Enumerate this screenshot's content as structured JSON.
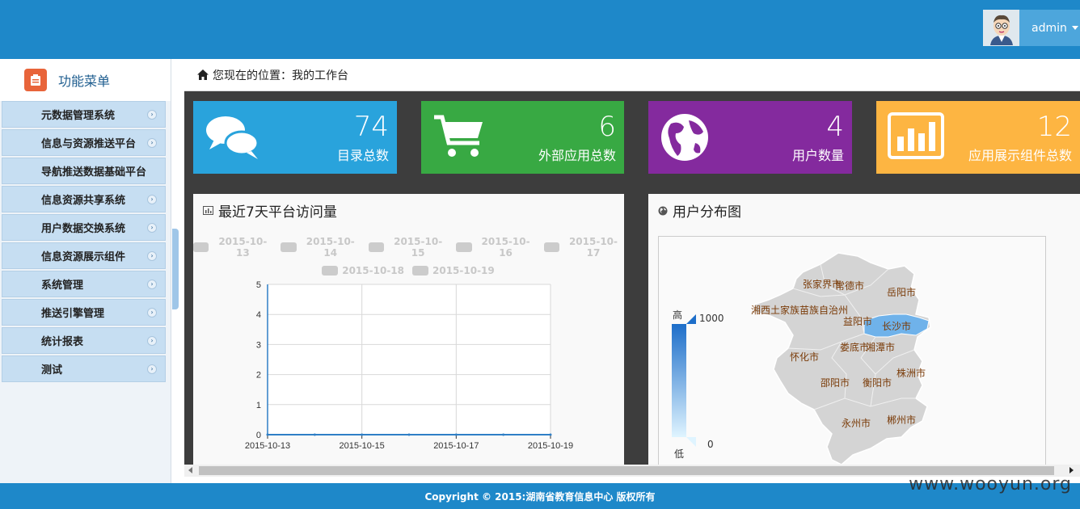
{
  "header": {
    "user_name": "admin"
  },
  "sidebar": {
    "title": "功能菜单",
    "items": [
      {
        "label": "元数据管理系统",
        "chevron": true
      },
      {
        "label": "信息与资源推送平台",
        "chevron": true
      },
      {
        "label": "导航推送数据基础平台",
        "chevron": false
      },
      {
        "label": "信息资源共享系统",
        "chevron": true
      },
      {
        "label": "用户数据交换系统",
        "chevron": true
      },
      {
        "label": "信息资源展示组件",
        "chevron": true
      },
      {
        "label": "系统管理",
        "chevron": true
      },
      {
        "label": "推送引擎管理",
        "chevron": true
      },
      {
        "label": "统计报表",
        "chevron": true
      },
      {
        "label": "测试",
        "chevron": true
      }
    ]
  },
  "breadcrumb": {
    "text": "您现在的位置：我的工作台"
  },
  "stats": [
    {
      "value": "74",
      "label": "目录总数",
      "color": "#29a3dc",
      "icon": "chat-icon"
    },
    {
      "value": "6",
      "label": "外部应用总数",
      "color": "#38a943",
      "icon": "cart-icon"
    },
    {
      "value": "4",
      "label": "用户数量",
      "color": "#842a9e",
      "icon": "globe-icon"
    },
    {
      "value": "12",
      "label": "应用展示组件总数",
      "color": "#fdb542",
      "icon": "bar-chart-icon"
    }
  ],
  "visits_panel": {
    "title": "最近7天平台访问量"
  },
  "map_panel": {
    "title": "用户分布图",
    "scale_high": "高",
    "scale_low": "低",
    "scale_max": "1000",
    "scale_min": "0",
    "cities": [
      "张家界市",
      "常德市",
      "岳阳市",
      "湘西土家族苗族自治州",
      "益阳市",
      "长沙市",
      "怀化市",
      "娄底市",
      "湘潭市",
      "株洲市",
      "邵阳市",
      "衡阳市",
      "永州市",
      "郴州市"
    ],
    "highlight_city": "长沙市",
    "highlight_color": "#6fb2ea",
    "region_color": "#d4d4d4"
  },
  "chart_data": {
    "type": "line",
    "title": "最近7天平台访问量",
    "legend": [
      "2015-10-13",
      "2015-10-14",
      "2015-10-15",
      "2015-10-16",
      "2015-10-17",
      "2015-10-18",
      "2015-10-19"
    ],
    "x": [
      "2015-10-13",
      "2015-10-14",
      "2015-10-15",
      "2015-10-16",
      "2015-10-17",
      "2015-10-18",
      "2015-10-19"
    ],
    "x_tick_labels": [
      "2015-10-13",
      "2015-10-15",
      "2015-10-17",
      "2015-10-19"
    ],
    "series": [
      {
        "values": [
          0,
          0,
          0,
          0,
          0,
          0,
          0
        ]
      }
    ],
    "ylim": [
      0,
      5
    ],
    "y_ticks": [
      0,
      1,
      2,
      3,
      4,
      5
    ],
    "grid": true,
    "legend_placement": "top",
    "line_color": "#2f7fc6"
  },
  "footer": {
    "copyright": "Copyright © 2015:湖南省教育信息中心 版权所有"
  },
  "watermark": "www.wooyun.org"
}
